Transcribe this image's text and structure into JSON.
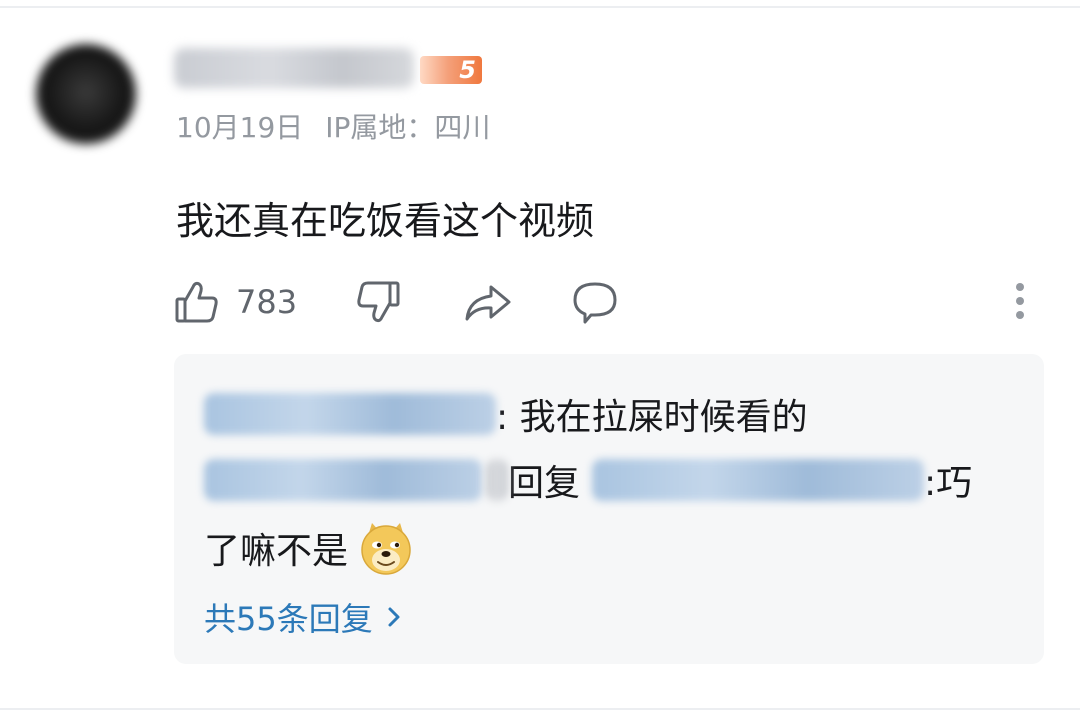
{
  "comment": {
    "level_badge": "5",
    "date": "10月19日",
    "ip_location": "IP属地：四川",
    "text": "我还真在吃饭看这个视频",
    "like_count": "783"
  },
  "reply_box": {
    "reply1_text": ": 我在拉屎时候看的",
    "reply2_mid": "回复",
    "reply2_end": " :巧",
    "reply2_line2": "了嘛不是",
    "reply_count_label": "共55条回复"
  },
  "icons": [
    "thumbs-up-icon",
    "thumbs-down-icon",
    "share-icon",
    "comment-bubble-icon",
    "more-vertical-icon",
    "doge-emoji-icon",
    "chevron-right-icon"
  ],
  "colors": {
    "secondary_text": "#9499a0",
    "link_blue": "#2c79b8",
    "reply_bg": "#f6f7f8",
    "level_badge": "#f0783e"
  }
}
